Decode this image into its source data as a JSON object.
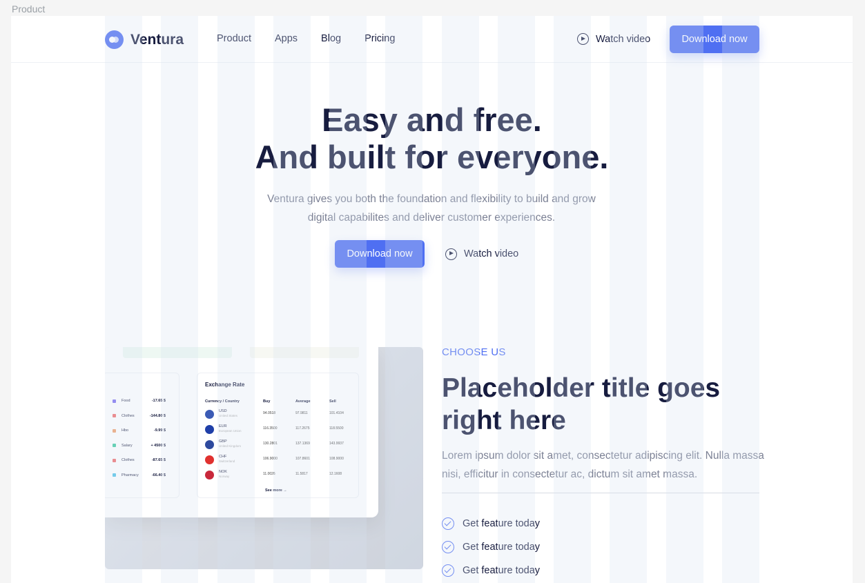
{
  "frame_label": "Product",
  "nav": {
    "brand": "Ventura",
    "menu": [
      "Product",
      "Apps",
      "Blog",
      "Pricing"
    ],
    "watch_label": "Watch video",
    "download_label": "Download now"
  },
  "hero": {
    "title_line1": "Easy and free.",
    "title_line2": "And built for everyone.",
    "subtitle_line1": "Ventura gives you both the foundation and flexibility to build and grow",
    "subtitle_line2": "digital capabilites and deliver customer experiences.",
    "download_label": "Download now",
    "watch_label": "Watch video"
  },
  "mockup": {
    "transactions": [
      {
        "name": "Food",
        "amount": "-17.65 $",
        "color": "#7b6cf0"
      },
      {
        "name": "Clothes",
        "amount": "-144.80 $",
        "color": "#f06c6c"
      },
      {
        "name": "Hbo",
        "amount": "-9.99 $",
        "color": "#f0a06c"
      },
      {
        "name": "Salary",
        "amount": "+ 4500 $",
        "color": "#3cc9a0"
      },
      {
        "name": "Clothes",
        "amount": "-87.65 $",
        "color": "#f06c6c"
      },
      {
        "name": "Pharmacy",
        "amount": "-66.40 $",
        "color": "#4fc3e8"
      }
    ],
    "exchange": {
      "title": "Exchange Rate",
      "headers": [
        "Currency / Country",
        "Buy",
        "Average",
        "Sell"
      ],
      "rows": [
        {
          "code": "USD",
          "country": "United States",
          "buy": "94.0518",
          "avg": "97.9811",
          "sell": "101.4104",
          "flag": "#3b5bb5"
        },
        {
          "code": "EUR",
          "country": "European Union",
          "buy": "116.3500",
          "avg": "117.2675",
          "sell": "118.5500",
          "flag": "#1f3fa8"
        },
        {
          "code": "GBP",
          "country": "United Kingdom",
          "buy": "130.2801",
          "avg": "137.1369",
          "sell": "143.9937",
          "flag": "#2e4a9e"
        },
        {
          "code": "CHF",
          "country": "Switzerland",
          "buy": "106.9000",
          "avg": "107.8601",
          "sell": "108.9000",
          "flag": "#e0312f"
        },
        {
          "code": "NOK",
          "country": "Norway",
          "buy": "11.0026",
          "avg": "11.5817",
          "sell": "12.1608",
          "flag": "#c8283b"
        }
      ],
      "see_more": "See more →"
    }
  },
  "section": {
    "eyebrow": "CHOOSE US",
    "title": "Placeholder title goes right here",
    "text": "Lorem ipsum dolor sit amet, consectetur adipiscing elit. Nulla massa nisi, efficitur in consectetur ac, dictum sit amet massa.",
    "features": [
      "Get feature today",
      "Get feature today",
      "Get feature today"
    ]
  },
  "colors": {
    "accent": "#4f6ff2",
    "heading": "#171c3f",
    "muted": "#7b8094"
  }
}
